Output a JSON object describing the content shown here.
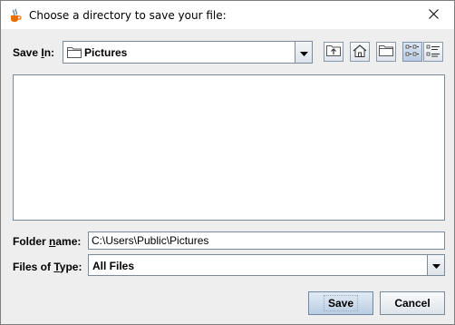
{
  "window": {
    "title": "Choose a directory to save your file:",
    "app_icon": "java-cup-icon",
    "close_icon": "close-icon"
  },
  "save_in": {
    "label_prefix": "Save ",
    "label_mnemonic": "I",
    "label_suffix": "n:",
    "selected": "Pictures",
    "folder_icon": "folder-icon"
  },
  "toolbar": {
    "buttons": [
      "up-one-level-icon",
      "home-icon",
      "new-folder-icon",
      "list-view-icon",
      "details-view-icon"
    ]
  },
  "folder_name": {
    "label_prefix": "Folder ",
    "label_mnemonic": "n",
    "label_suffix": "ame:",
    "value": "C:\\Users\\Public\\Pictures"
  },
  "files_of_type": {
    "label_prefix": "Files of ",
    "label_mnemonic": "T",
    "label_suffix": "ype:",
    "selected": "All Files"
  },
  "actions": {
    "save_label": "Save",
    "cancel_label": "Cancel"
  },
  "colors": {
    "window_bg": "#eeeeee",
    "border": "#7a8a99",
    "active_toggle": "#b8cbe1"
  }
}
